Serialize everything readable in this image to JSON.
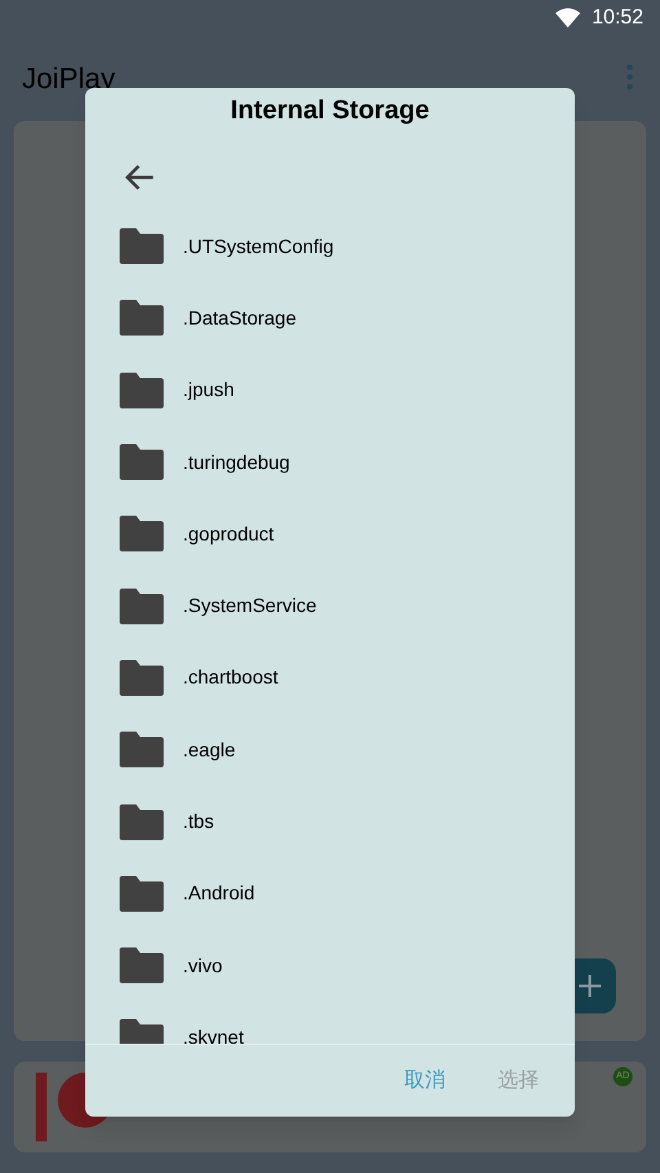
{
  "status_bar": {
    "time": "10:52"
  },
  "app_bar": {
    "title": "JoiPlay"
  },
  "banner": {
    "badge": "AD"
  },
  "dialog": {
    "title": "Internal Storage",
    "items": [
      {
        "name": ".UTSystemConfig"
      },
      {
        "name": ".DataStorage"
      },
      {
        "name": ".jpush"
      },
      {
        "name": ".turingdebug"
      },
      {
        "name": ".goproduct"
      },
      {
        "name": ".SystemService"
      },
      {
        "name": ".chartboost"
      },
      {
        "name": ".eagle"
      },
      {
        "name": ".tbs"
      },
      {
        "name": ".Android"
      },
      {
        "name": ".vivo"
      },
      {
        "name": ".skvnet"
      }
    ],
    "buttons": [
      {
        "label": "取消",
        "disabled": false
      },
      {
        "label": "选择",
        "disabled": true
      }
    ]
  }
}
